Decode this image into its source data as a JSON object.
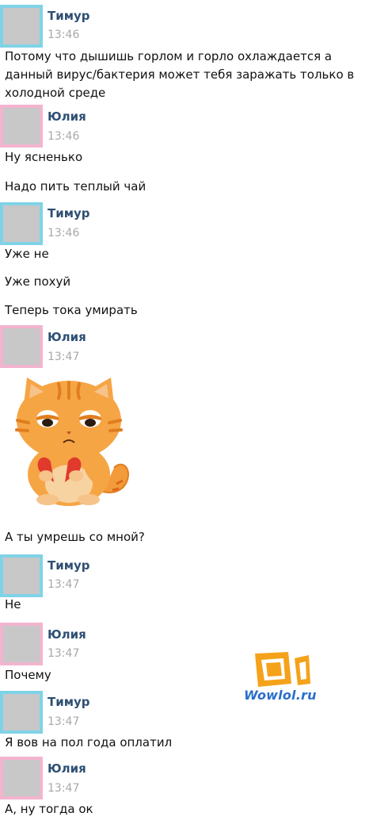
{
  "messages": [
    {
      "sender": "Тимур",
      "time": "13:46",
      "lines": [
        "Потому что дышишь горлом и горло охлаждается а данный вирус/бактерия может тебя заражать только в холодной среде"
      ]
    },
    {
      "sender": "Юлия",
      "time": "13:46",
      "lines": [
        "Ну ясненько",
        "Надо пить теплый чай"
      ]
    },
    {
      "sender": "Тимур",
      "time": "13:46",
      "lines": [
        "Уже не",
        "Уже похуй",
        "Теперь тока умирать"
      ]
    },
    {
      "sender": "Юлия",
      "time": "13:47",
      "sticker": "sad-cat-broken-heart-sticker",
      "lines": [
        "А ты умрешь со мной?"
      ]
    },
    {
      "sender": "Тимур",
      "time": "13:47",
      "lines": [
        "Не"
      ]
    },
    {
      "sender": "Юлия",
      "time": "13:47",
      "lines": [
        "Почему"
      ]
    },
    {
      "sender": "Тимур",
      "time": "13:47",
      "lines": [
        "Я вов на пол года оплатил"
      ]
    },
    {
      "sender": "Юлия",
      "time": "13:47",
      "lines": [
        "А, ну тогда ок"
      ]
    }
  ],
  "watermark": {
    "text": "Wowlol.ru",
    "icon": "wowlol-logo-icon"
  },
  "colors": {
    "timur_avatar_border": "#7fd3e6",
    "yulia_avatar_border": "#f3b4cf",
    "name": "#2e4f73",
    "time": "#a8a8a8",
    "watermark": "#2a6fc9"
  }
}
